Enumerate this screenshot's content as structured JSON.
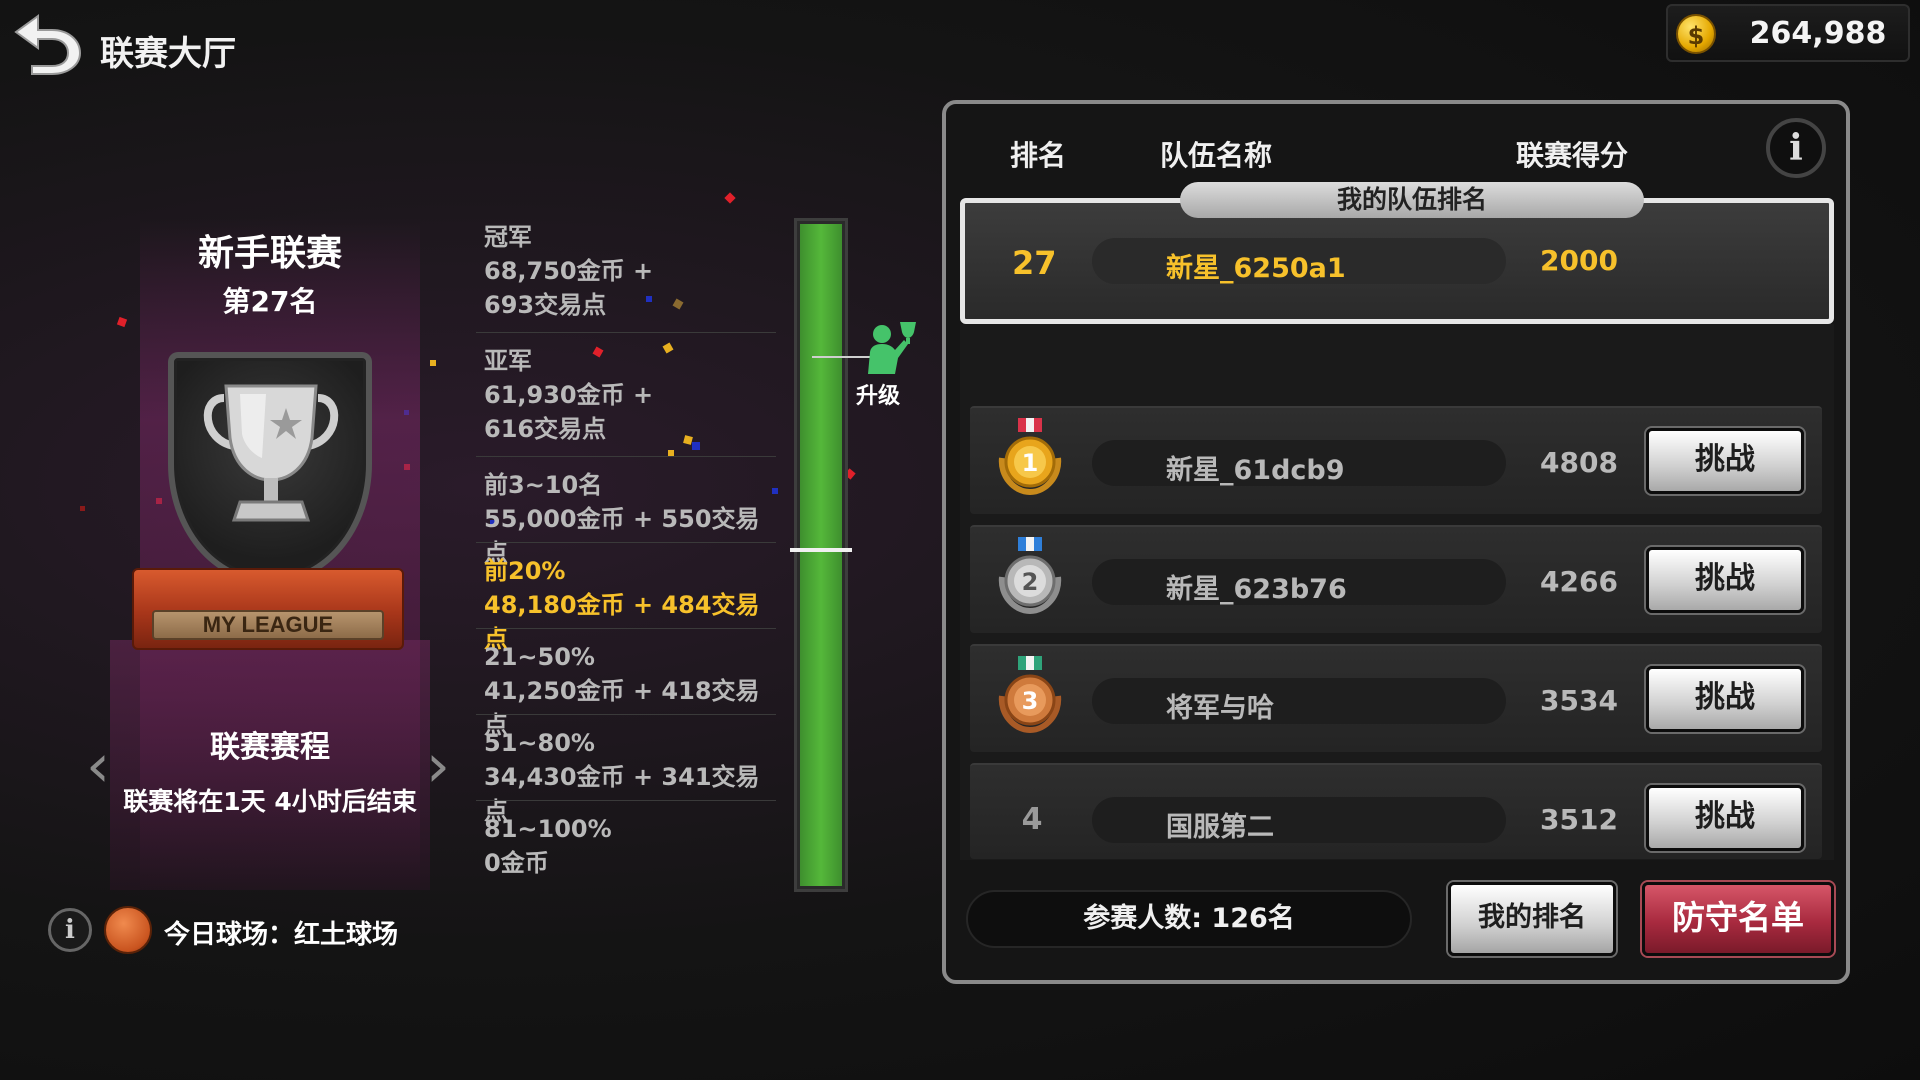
{
  "header": {
    "title": "联赛大厅",
    "coins": "264,988",
    "coin_symbol": "$"
  },
  "league": {
    "name": "新手联赛",
    "rank": "第27名",
    "pedestal_label": "MY LEAGUE",
    "schedule_title": "联赛赛程",
    "schedule_desc": "联赛将在1天 4小时后结束",
    "prev_arrow": "‹",
    "next_arrow": "›",
    "court_text": "今日球场：红土球场"
  },
  "rewards": [
    {
      "tier": "冠军",
      "line1": "68,750金币 +",
      "line2": "693交易点",
      "highlight": false
    },
    {
      "tier": "亚军",
      "line1": "61,930金币 +",
      "line2": "616交易点",
      "highlight": false
    },
    {
      "tier": "前3~10名",
      "line1": "55,000金币 + 550交易点",
      "highlight": false
    },
    {
      "tier": "前20%",
      "line1": "48,180金币 + 484交易点",
      "highlight": true
    },
    {
      "tier": "21~50%",
      "line1": "41,250金币 + 418交易点",
      "highlight": false
    },
    {
      "tier": "51~80%",
      "line1": "34,430金币 + 341交易点",
      "highlight": false
    },
    {
      "tier": "81~100%",
      "line1": "0金币",
      "highlight": false
    }
  ],
  "progress": {
    "promote_label": "升级"
  },
  "table": {
    "col_rank": "排名",
    "col_team": "队伍名称",
    "col_score": "联赛得分",
    "info_icon": "i",
    "my_tab": "我的队伍排名",
    "my_row": {
      "rank": "27",
      "team": "新星_6250a1",
      "score": "2000"
    },
    "rows": [
      {
        "rank": "1",
        "team": "新星_61dcb9",
        "score": "4808",
        "medal": "gold",
        "action": "挑战"
      },
      {
        "rank": "2",
        "team": "新星_623b76",
        "score": "4266",
        "medal": "silver",
        "action": "挑战"
      },
      {
        "rank": "3",
        "team": "将军与哈",
        "score": "3534",
        "medal": "bronze",
        "action": "挑战"
      },
      {
        "rank": "4",
        "team": "国服第二",
        "score": "3512",
        "medal": "",
        "action": "挑战"
      }
    ]
  },
  "footer": {
    "participants": "参赛人数: 126名",
    "my_rank_button": "我的排名",
    "defend_button": "防守名单"
  },
  "colors": {
    "highlight": "#f7c12b",
    "progress_green": "#55b83a",
    "defend_red": "#a82a3f"
  }
}
